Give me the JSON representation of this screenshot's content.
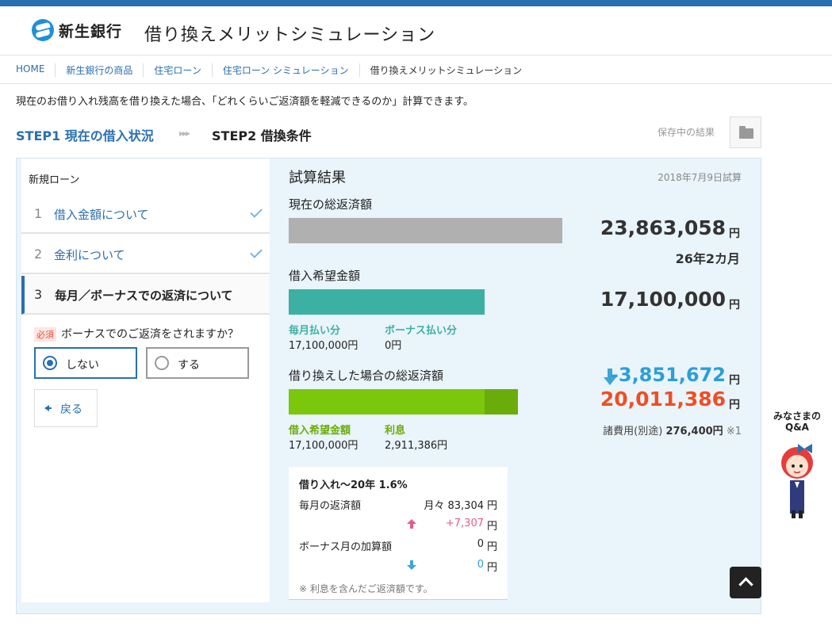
{
  "brand": {
    "name": "新生銀行"
  },
  "page": {
    "title": "借り換えメリットシミュレーション"
  },
  "breadcrumb": [
    "HOME",
    "新生銀行の商品",
    "住宅ローン",
    "住宅ローン シミュレーション",
    "借り換えメリットシミュレーション"
  ],
  "intro": "現在のお借り入れ残高を借り換えた場合、「どれくらいご返済額を軽減できるのか」計算できます。",
  "steps": {
    "step1": "STEP1 現在の借入状況",
    "arrows": "▸▸▸",
    "step2": "STEP2 借換条件"
  },
  "saved": {
    "label": "保存中の結果"
  },
  "left": {
    "title": "新規ローン",
    "items": [
      {
        "num": "1",
        "label": "借入金額について"
      },
      {
        "num": "2",
        "label": "金利について"
      },
      {
        "num": "3",
        "label": "毎月／ボーナスでの返済について"
      }
    ],
    "required_badge": "必須",
    "question": "ボーナスでのご返済をされますか？",
    "options": [
      {
        "label": "しない",
        "selected": true
      },
      {
        "label": "する",
        "selected": false
      }
    ],
    "back": "戻る"
  },
  "result": {
    "title": "試算結果",
    "date": "2018年7月9日試算",
    "current": {
      "label": "現在の総返済額",
      "amount": "23,863,058",
      "unit": "円",
      "term": "26年2カ月",
      "color": "#b0b0b0"
    },
    "desired": {
      "label": "借入希望金額",
      "amount": "17,100,000",
      "unit": "円",
      "color": "#3db0a4",
      "monthly_label": "毎月払い分",
      "monthly_value": "17,100,000円",
      "bonus_label": "ボーナス払い分",
      "bonus_value": "0円"
    },
    "refinance": {
      "label": "借り換えした場合の総返済額",
      "diff": "-3,851,672",
      "diff_unit": "円",
      "amount": "20,011,386",
      "unit": "円",
      "principal_label": "借入希望金額",
      "principal_value": "17,100,000円",
      "interest_label": "利息",
      "interest_value": "2,911,386円",
      "fees_label": "諸費用(別途)",
      "fees_value": "276,400円",
      "fees_note": "※1",
      "color_principal": "#7ac70c",
      "color_interest": "#6aac0a"
    },
    "detail": {
      "heading": "借り入れ～20年 1.6%",
      "monthly_label": "毎月の返済額",
      "monthly_value": "月々 83,304",
      "monthly_unit": "円",
      "monthly_diff": "+7,307",
      "monthly_diff_unit": "円",
      "bonus_label": "ボーナス月の加算額",
      "bonus_value": "0",
      "bonus_unit": "円",
      "bonus_diff": "0",
      "bonus_diff_unit": "円",
      "note": "※ 利息を含んだご返済額です。"
    }
  },
  "qa": {
    "label_line1": "みなさまの",
    "label_line2": "Q&A"
  }
}
